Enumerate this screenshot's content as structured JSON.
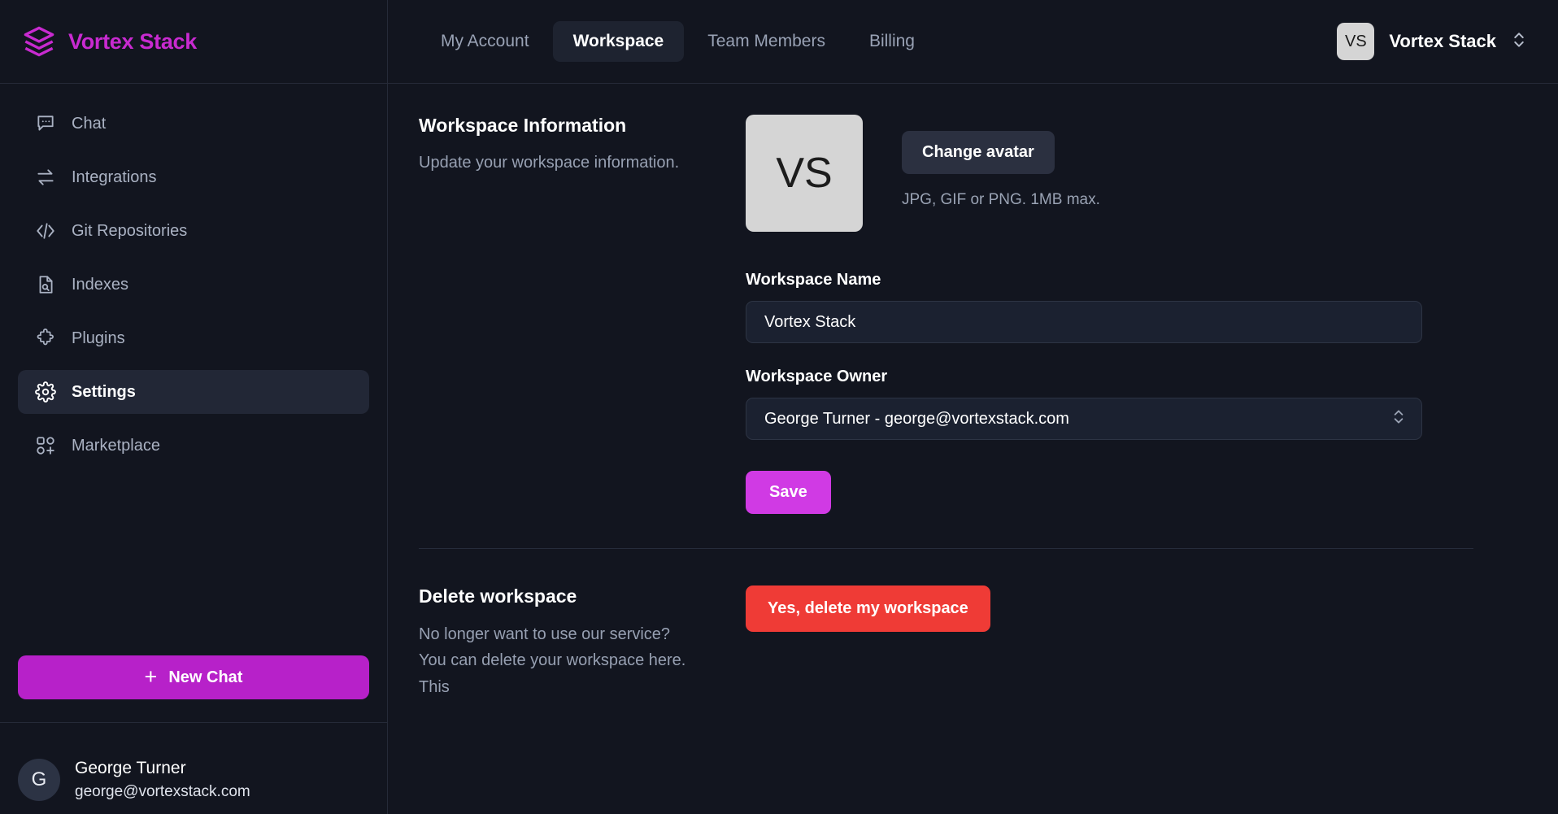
{
  "brand": {
    "name": "Vortex Stack",
    "logo_icon": "layers-stack-icon",
    "color": "#c82ad0"
  },
  "sidebar": {
    "items": [
      {
        "label": "Chat",
        "icon": "chat-bubble-icon",
        "active": false
      },
      {
        "label": "Integrations",
        "icon": "swap-arrows-icon",
        "active": false
      },
      {
        "label": "Git Repositories",
        "icon": "code-brackets-icon",
        "active": false
      },
      {
        "label": "Indexes",
        "icon": "document-search-icon",
        "active": false
      },
      {
        "label": "Plugins",
        "icon": "puzzle-piece-icon",
        "active": false
      },
      {
        "label": "Settings",
        "icon": "gear-icon",
        "active": true
      },
      {
        "label": "Marketplace",
        "icon": "grid-plus-icon",
        "active": false
      }
    ],
    "new_chat_label": "New Chat",
    "new_chat_icon": "plus-icon",
    "new_chat_color": "#b721c9",
    "user": {
      "initial": "G",
      "name": "George Turner",
      "email": "george@vortexstack.com"
    }
  },
  "topbar": {
    "tabs": [
      {
        "label": "My Account",
        "active": false
      },
      {
        "label": "Workspace",
        "active": true
      },
      {
        "label": "Team Members",
        "active": false
      },
      {
        "label": "Billing",
        "active": false
      }
    ],
    "workspace_selector": {
      "initials": "VS",
      "name": "Vortex Stack",
      "icon": "chevron-up-down-icon"
    }
  },
  "main": {
    "info": {
      "title": "Workspace Information",
      "description": "Update your workspace information.",
      "avatar_initials": "VS",
      "change_avatar_label": "Change avatar",
      "avatar_hint": "JPG, GIF or PNG. 1MB max.",
      "name_label": "Workspace Name",
      "name_value": "Vortex Stack",
      "owner_label": "Workspace Owner",
      "owner_value": "George Turner - george@vortexstack.com",
      "save_label": "Save",
      "save_color": "#d03ae4"
    },
    "danger": {
      "title": "Delete workspace",
      "description": "No longer want to use our service? You can delete your workspace here. This",
      "delete_label": "Yes, delete my workspace",
      "delete_color": "#ef3b36"
    }
  }
}
